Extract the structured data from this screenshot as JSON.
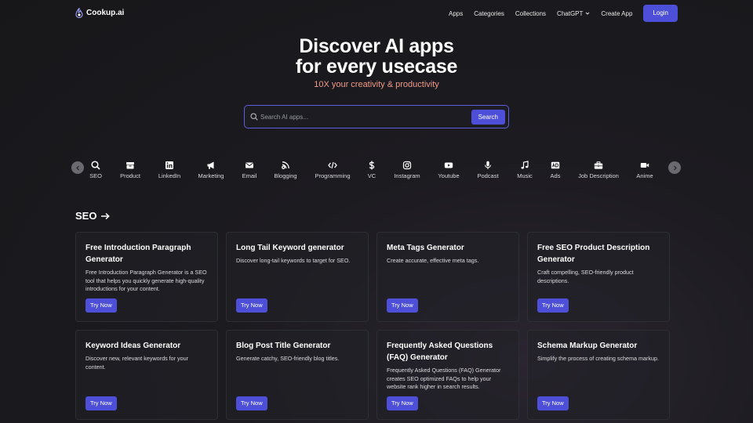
{
  "header": {
    "logo_text": "Cookup.ai",
    "nav": [
      "Apps",
      "Categories",
      "Collections",
      "ChatGPT",
      "Create App"
    ],
    "login_label": "Login"
  },
  "hero": {
    "title_line1": "Discover AI apps",
    "title_line2": "for every usecase",
    "subtitle": "10X your creativity & productivity"
  },
  "search": {
    "placeholder": "Search AI apps...",
    "button_label": "Search"
  },
  "categories": [
    {
      "label": "SEO",
      "icon": "search-icon"
    },
    {
      "label": "Product",
      "icon": "product-icon"
    },
    {
      "label": "LinkedIn",
      "icon": "linkedin-icon"
    },
    {
      "label": "Marketing",
      "icon": "megaphone-icon"
    },
    {
      "label": "Email",
      "icon": "envelope-icon"
    },
    {
      "label": "Blogging",
      "icon": "blog-icon"
    },
    {
      "label": "Programming",
      "icon": "code-icon"
    },
    {
      "label": "VC",
      "icon": "dollar-icon"
    },
    {
      "label": "Instagram",
      "icon": "instagram-icon"
    },
    {
      "label": "Youtube",
      "icon": "youtube-icon"
    },
    {
      "label": "Podcast",
      "icon": "microphone-icon"
    },
    {
      "label": "Music",
      "icon": "music-note-icon"
    },
    {
      "label": "Ads",
      "icon": "ad-icon"
    },
    {
      "label": "Job Description",
      "icon": "briefcase-icon"
    },
    {
      "label": "Anime",
      "icon": "video-camera-icon"
    }
  ],
  "section": {
    "title": "SEO",
    "cards": [
      {
        "title": "Free Introduction Paragraph Generator",
        "desc": "Free Introduction Paragraph Generator is a SEO tool that helps you quickly generate high-quality introductions for your content.",
        "button": "Try Now"
      },
      {
        "title": "Long Tail Keyword generator",
        "desc": "Discover long-tail keywords to target for SEO.",
        "button": "Try Now"
      },
      {
        "title": "Meta Tags Generator",
        "desc": "Create accurate, effective meta tags.",
        "button": "Try Now"
      },
      {
        "title": "Free SEO Product Description Generator",
        "desc": "Craft compelling, SEO-friendly product descriptions.",
        "button": "Try Now"
      },
      {
        "title": "Keyword Ideas Generator",
        "desc": "Discover new, relevant keywords for your content.",
        "button": "Try Now"
      },
      {
        "title": "Blog Post Title Generator",
        "desc": "Generate catchy, SEO-friendly blog titles.",
        "button": "Try Now"
      },
      {
        "title": "Frequently Asked Questions (FAQ) Generator",
        "desc": "Frequently Asked Questions (FAQ) Generator creates SEO optimized FAQs to help your website rank higher in search results.",
        "button": "Try Now"
      },
      {
        "title": "Schema Markup Generator",
        "desc": "Simplify the process of creating schema markup.",
        "button": "Try Now"
      }
    ]
  },
  "colors": {
    "accent": "#4d4fd8",
    "subtitle": "#f09a8a"
  }
}
